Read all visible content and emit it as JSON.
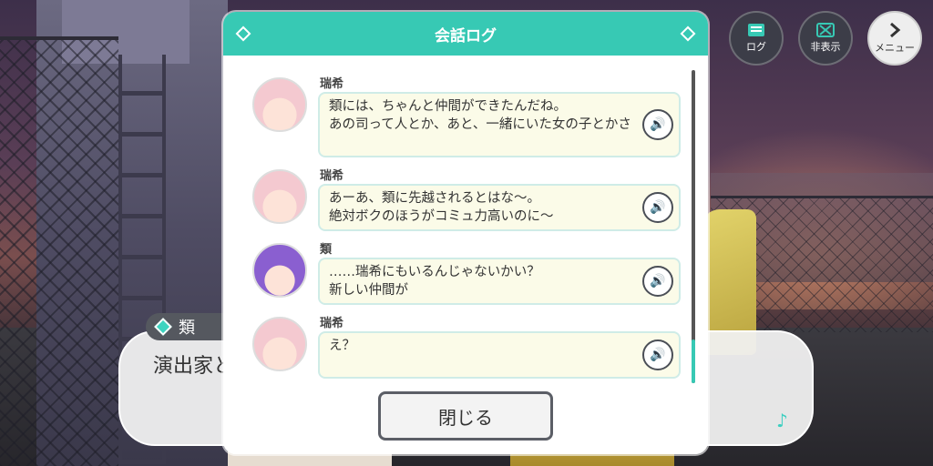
{
  "controls": {
    "log_label": "ログ",
    "hide_label": "非表示",
    "menu_label": "メニュー"
  },
  "dialogue": {
    "speaker": "類",
    "text": "演出家と"
  },
  "log": {
    "title": "会話ログ",
    "entries": [
      {
        "speaker": "瑞希",
        "text": "類には、ちゃんと仲間ができたんだね。\nあの司って人とか、あと、一緒にいた女の子とかさ"
      },
      {
        "speaker": "瑞希",
        "text": "あーあ、類に先越されるとはな〜。\n絶対ボクのほうがコミュ力高いのに〜"
      },
      {
        "speaker": "類",
        "text": "……瑞希にもいるんじゃないかい？\n新しい仲間が"
      },
      {
        "speaker": "瑞希",
        "text": "え？"
      }
    ],
    "close_label": "閉じる"
  },
  "icons": {
    "voice": "speaker-icon",
    "log": "log-icon",
    "hide": "hide-icon",
    "menu": "chevron-right-icon",
    "note": "music-note-icon"
  },
  "colors": {
    "accent": "#37c9b4",
    "bubble_bg": "#fbfbe8"
  }
}
